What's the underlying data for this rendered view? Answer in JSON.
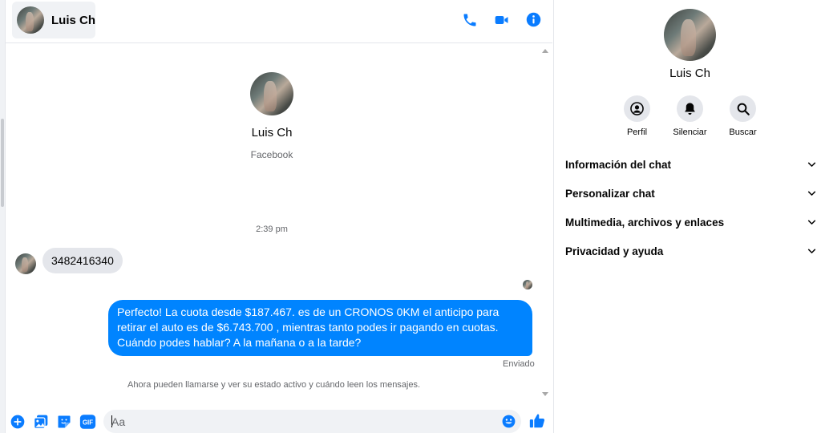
{
  "contact": {
    "name": "Luis Ch",
    "source": "Facebook"
  },
  "header": {
    "icons": [
      "phone-icon",
      "video-icon",
      "info-icon"
    ]
  },
  "conversation": {
    "timestamp": "2:39 pm",
    "incoming_message": "3482416340",
    "outgoing_message": "Perfecto! La cuota desde $187.467. es de un CRONOS 0KM el anticipo para retirar el auto es de $6.743.700 , mientras tanto podes ir pagando en cuotas. Cuándo podes hablar? A la mañana o a la tarde?",
    "sent_status": "Enviado",
    "notice": "Ahora pueden llamarse y ver su estado activo y cuándo leen los mensajes."
  },
  "composer": {
    "placeholder": "Aa",
    "icons": [
      "plus-icon",
      "image-icon",
      "sticker-icon",
      "gif-icon",
      "emoji-icon",
      "like-icon"
    ],
    "gif_label": "GIF"
  },
  "right_panel": {
    "actions": [
      {
        "label": "Perfil",
        "icon": "profile-icon"
      },
      {
        "label": "Silenciar",
        "icon": "bell-icon"
      },
      {
        "label": "Buscar",
        "icon": "search-icon"
      }
    ],
    "sections": [
      {
        "title": "Información del chat"
      },
      {
        "title": "Personalizar chat"
      },
      {
        "title": "Multimedia, archivos y enlaces"
      },
      {
        "title": "Privacidad y ayuda"
      }
    ]
  },
  "colors": {
    "accent": "#0084ff",
    "icon_blue": "#0a7cff",
    "bubble_in": "#e4e6eb",
    "panel_bg": "#f0f2f5",
    "muted_text": "#65676b"
  }
}
